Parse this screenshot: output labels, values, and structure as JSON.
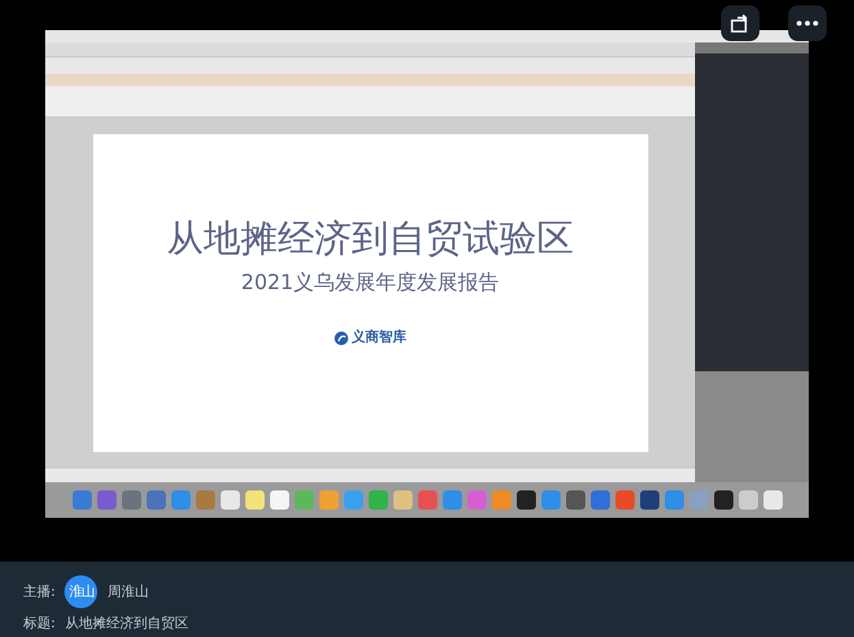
{
  "slide": {
    "title": "从地摊经济到自贸试验区",
    "subtitle": "2021义乌发展年度发展报告",
    "logo_text": "义商智库"
  },
  "stream_info": {
    "host_label": "主播:",
    "host_avatar": "淮山",
    "host_name": "周淮山",
    "title_label": "标题:",
    "title": "从地摊经济到自贸区"
  }
}
